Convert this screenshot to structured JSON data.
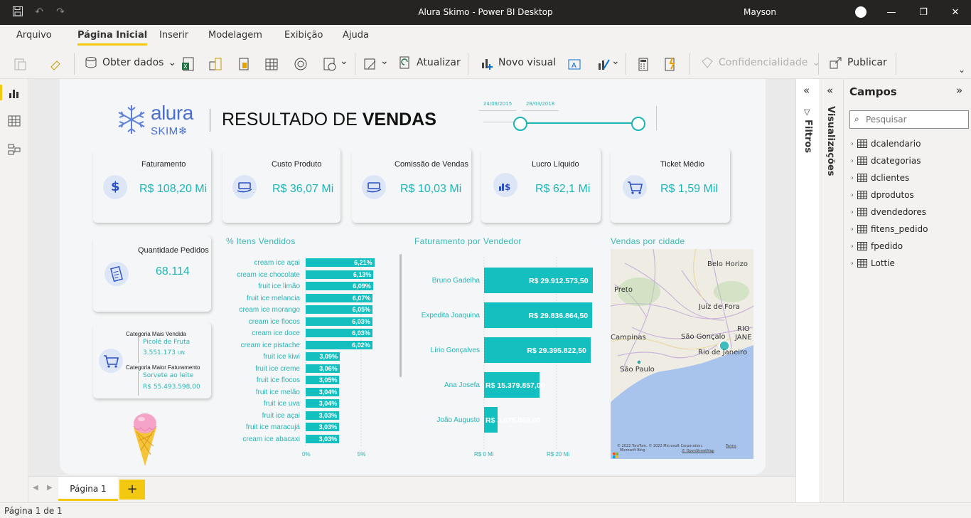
{
  "window": {
    "title": "Alura Skimo - Power BI Desktop",
    "user": "Mayson"
  },
  "menu": [
    "Arquivo",
    "Página Inicial",
    "Inserir",
    "Modelagem",
    "Exibição",
    "Ajuda"
  ],
  "ribbon": {
    "obter_dados": "Obter dados",
    "atualizar": "Atualizar",
    "novo_visual": "Novo visual",
    "confidencialidade": "Confidencialidade",
    "publicar": "Publicar"
  },
  "report": {
    "logo_top": "alura",
    "logo_bottom": "SKIM",
    "title_regular": "RESULTADO DE ",
    "title_bold": "VENDAS",
    "slicer_start": "24/09/2015",
    "slicer_end": "28/03/2018",
    "kpis": [
      {
        "label": "Faturamento",
        "value": "R$ 108,20 Mi",
        "icon": "dollar-icon"
      },
      {
        "label": "Custo Produto",
        "value": "R$ 36,07 Mi",
        "icon": "money-hand-icon"
      },
      {
        "label": "Comissão de Vendas",
        "value": "R$ 10,03 Mi",
        "icon": "money-hand-icon"
      },
      {
        "label": "Lucro Líquido",
        "value": "R$ 62,1 Mi",
        "icon": "chart-dollar-icon"
      },
      {
        "label": "Ticket Médio",
        "value": "R$ 1,59 Mil",
        "icon": "cart-icon"
      }
    ],
    "pedidos": {
      "label": "Quantidade Pedidos",
      "value": "68.114"
    },
    "categoria": {
      "mais_vendida_label": "Categoria Mais Vendida",
      "mais_vendida_name": "Picolé de Fruta",
      "mais_vendida_qty": "3.551.173",
      "mais_vendida_unit": "UN",
      "maior_fat_label": "Categoria Maior Faturamento",
      "maior_fat_name": "Sorvete ao leite",
      "maior_fat_value": "R$ 55.493.598,00"
    },
    "map": {
      "title": "Vendas por cidade",
      "places": [
        "Belo Horizo",
        "Preto",
        "Juiz de Fora",
        "RIO",
        "JANE",
        "Campinas",
        "São Gonçalo",
        "Rio de Janeiro",
        "São Paulo"
      ],
      "copyright": "© 2022 TomTom, © 2022 Microsoft Corporation,",
      "terms": "Terms",
      "osm": "© OpenStreetMap",
      "bing": "Microsoft Bing"
    }
  },
  "chart_data": [
    {
      "type": "bar",
      "title": "% Itens Vendidos",
      "orientation": "horizontal",
      "categories": [
        "cream ice açai",
        "cream ice chocolate",
        "fruit ice limão",
        "fruit ice melancia",
        "cream ice morango",
        "cream ice flocos",
        "cream ice doce",
        "cream ice pistache",
        "fruit ice kiwi",
        "fruit ice creme",
        "fruit ice flocos",
        "fruit ice melão",
        "fruit ice uva",
        "fruit ice açai",
        "fruit ice maracujá",
        "cream ice abacaxi"
      ],
      "values": [
        6.21,
        6.13,
        6.09,
        6.07,
        6.05,
        6.03,
        6.03,
        6.02,
        3.09,
        3.06,
        3.05,
        3.04,
        3.04,
        3.03,
        3.03,
        3.03
      ],
      "labels": [
        "6,21%",
        "6,13%",
        "6,09%",
        "6,07%",
        "6,05%",
        "6,03%",
        "6,03%",
        "6,02%",
        "3,09%",
        "3,06%",
        "3,05%",
        "3,04%",
        "3,04%",
        "3,03%",
        "3,03%",
        "3,03%"
      ],
      "xticks": [
        "0%",
        "5%"
      ],
      "xlim": [
        0,
        7.2
      ],
      "color": "#14bfbf"
    },
    {
      "type": "bar",
      "title": "Faturamento por Vendedor",
      "orientation": "horizontal",
      "categories": [
        "Bruno Gadelha",
        "Expedita Joaquina",
        "Lírio Gonçalves",
        "Ana Josefa",
        "João Augusto"
      ],
      "values": [
        29912573.5,
        29836864.5,
        29395822.5,
        15379857.0,
        3675069.0
      ],
      "labels": [
        "R$ 29.912.573,50",
        "R$ 29.836.864,50",
        "R$ 29.395.822,50",
        "R$ 15.379.857,00",
        "R$ 3.675.069,00"
      ],
      "xticks": [
        "R$ 0 Mi",
        "R$ 20 Mi"
      ],
      "xlim": [
        0,
        30000000
      ],
      "color": "#14bfbf"
    }
  ],
  "panels": {
    "filtros": "Filtros",
    "visualizacoes": "Visualizações",
    "campos": "Campos",
    "search_placeholder": "Pesquisar",
    "fields": [
      "dcalendario",
      "dcategorias",
      "dclientes",
      "dprodutos",
      "dvendedores",
      "fitens_pedido",
      "fpedido",
      "Lottie"
    ]
  },
  "pages": {
    "tab": "Página 1",
    "status": "Página 1 de 1"
  }
}
